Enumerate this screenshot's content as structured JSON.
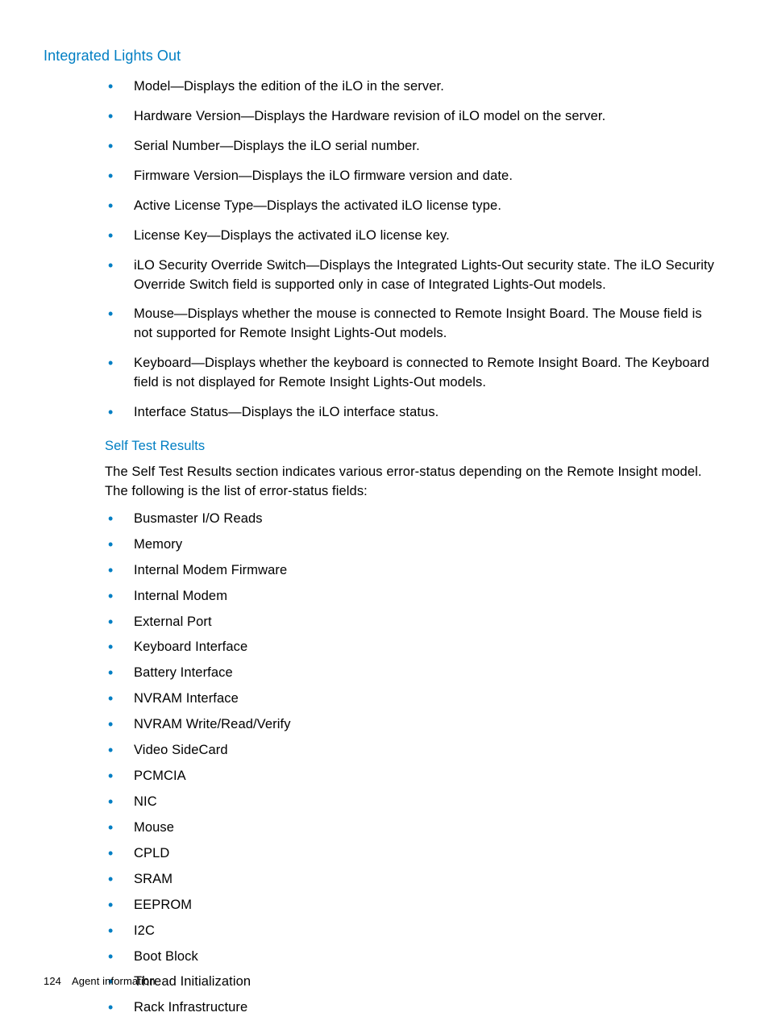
{
  "section": {
    "title": "Integrated Lights Out",
    "items": [
      "Model—Displays the edition of the iLO in the server.",
      "Hardware Version—Displays the Hardware revision of iLO model on the server.",
      "Serial Number—Displays the iLO serial number.",
      "Firmware Version—Displays the iLO firmware version and date.",
      "Active License Type—Displays the activated iLO license type.",
      "License Key—Displays the activated iLO license key.",
      "iLO Security Override Switch—Displays the Integrated Lights-Out security state.  The iLO Security Override Switch field is supported only in case of Integrated Lights-Out models.",
      "Mouse—Displays whether the mouse is connected to Remote Insight Board. The Mouse field is not supported for Remote Insight Lights-Out models.",
      "Keyboard—Displays whether the keyboard is connected to Remote Insight Board.  The Keyboard field is not displayed for Remote Insight Lights-Out models.",
      "Interface Status—Displays the iLO interface status."
    ]
  },
  "subsection": {
    "title": "Self Test Results",
    "intro": "The Self Test Results section indicates various error-status depending on the Remote Insight model.  The following is the list of error-status fields:",
    "items": [
      "Busmaster I/O Reads",
      "Memory",
      "Internal Modem Firmware",
      "Internal Modem",
      "External Port",
      "Keyboard Interface",
      "Battery Interface",
      "NVRAM Interface",
      "NVRAM Write/Read/Verify",
      "Video SideCard",
      "PCMCIA",
      "NIC",
      "Mouse",
      "CPLD",
      "SRAM",
      "EEPROM",
      "I2C",
      "Boot Block",
      "Thread Initialization",
      "Rack Infrastructure"
    ]
  },
  "footer": {
    "page_number": "124",
    "section_label": "Agent information"
  }
}
